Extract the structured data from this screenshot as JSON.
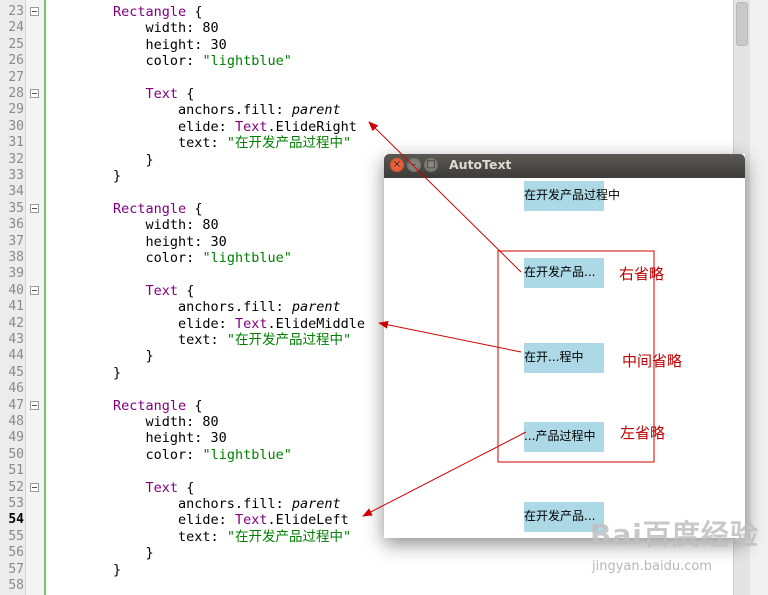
{
  "editor": {
    "current_line": "54",
    "lines": [
      {
        "n": "23",
        "fold": true,
        "segs": [
          {
            "t": "        ",
            "c": ""
          },
          {
            "t": "Rectangle",
            "c": "kw"
          },
          {
            "t": " {",
            "c": ""
          }
        ]
      },
      {
        "n": "24",
        "fold": false,
        "segs": [
          {
            "t": "            width: 80",
            "c": ""
          }
        ]
      },
      {
        "n": "25",
        "fold": false,
        "segs": [
          {
            "t": "            height: 30",
            "c": ""
          }
        ]
      },
      {
        "n": "26",
        "fold": false,
        "segs": [
          {
            "t": "            color: ",
            "c": ""
          },
          {
            "t": "\"lightblue\"",
            "c": "str"
          }
        ]
      },
      {
        "n": "27",
        "fold": false,
        "segs": []
      },
      {
        "n": "28",
        "fold": true,
        "segs": [
          {
            "t": "            ",
            "c": ""
          },
          {
            "t": "Text",
            "c": "kw"
          },
          {
            "t": " {",
            "c": ""
          }
        ]
      },
      {
        "n": "29",
        "fold": false,
        "segs": [
          {
            "t": "                anchors.fill: ",
            "c": ""
          },
          {
            "t": "parent",
            "c": "it"
          }
        ]
      },
      {
        "n": "30",
        "fold": false,
        "segs": [
          {
            "t": "                elide: ",
            "c": ""
          },
          {
            "t": "Text",
            "c": "kw"
          },
          {
            "t": ".ElideRight",
            "c": ""
          }
        ]
      },
      {
        "n": "31",
        "fold": false,
        "segs": [
          {
            "t": "                text: ",
            "c": ""
          },
          {
            "t": "\"在开发产品过程中\"",
            "c": "str"
          }
        ]
      },
      {
        "n": "32",
        "fold": false,
        "segs": [
          {
            "t": "            }",
            "c": ""
          }
        ]
      },
      {
        "n": "33",
        "fold": false,
        "segs": [
          {
            "t": "        }",
            "c": ""
          }
        ]
      },
      {
        "n": "34",
        "fold": false,
        "segs": []
      },
      {
        "n": "35",
        "fold": true,
        "segs": [
          {
            "t": "        ",
            "c": ""
          },
          {
            "t": "Rectangle",
            "c": "kw"
          },
          {
            "t": " {",
            "c": ""
          }
        ]
      },
      {
        "n": "36",
        "fold": false,
        "segs": [
          {
            "t": "            width: 80",
            "c": ""
          }
        ]
      },
      {
        "n": "37",
        "fold": false,
        "segs": [
          {
            "t": "            height: 30",
            "c": ""
          }
        ]
      },
      {
        "n": "38",
        "fold": false,
        "segs": [
          {
            "t": "            color: ",
            "c": ""
          },
          {
            "t": "\"lightblue\"",
            "c": "str"
          }
        ]
      },
      {
        "n": "39",
        "fold": false,
        "segs": []
      },
      {
        "n": "40",
        "fold": true,
        "segs": [
          {
            "t": "            ",
            "c": ""
          },
          {
            "t": "Text",
            "c": "kw"
          },
          {
            "t": " {",
            "c": ""
          }
        ]
      },
      {
        "n": "41",
        "fold": false,
        "segs": [
          {
            "t": "                anchors.fill: ",
            "c": ""
          },
          {
            "t": "parent",
            "c": "it"
          }
        ]
      },
      {
        "n": "42",
        "fold": false,
        "segs": [
          {
            "t": "                elide: ",
            "c": ""
          },
          {
            "t": "Text",
            "c": "kw"
          },
          {
            "t": ".ElideMiddle",
            "c": ""
          }
        ]
      },
      {
        "n": "43",
        "fold": false,
        "segs": [
          {
            "t": "                text: ",
            "c": ""
          },
          {
            "t": "\"在开发产品过程中\"",
            "c": "str"
          }
        ]
      },
      {
        "n": "44",
        "fold": false,
        "segs": [
          {
            "t": "            }",
            "c": ""
          }
        ]
      },
      {
        "n": "45",
        "fold": false,
        "segs": [
          {
            "t": "        }",
            "c": ""
          }
        ]
      },
      {
        "n": "46",
        "fold": false,
        "segs": []
      },
      {
        "n": "47",
        "fold": true,
        "segs": [
          {
            "t": "        ",
            "c": ""
          },
          {
            "t": "Rectangle",
            "c": "kw"
          },
          {
            "t": " {",
            "c": ""
          }
        ]
      },
      {
        "n": "48",
        "fold": false,
        "segs": [
          {
            "t": "            width: 80",
            "c": ""
          }
        ]
      },
      {
        "n": "49",
        "fold": false,
        "segs": [
          {
            "t": "            height: 30",
            "c": ""
          }
        ]
      },
      {
        "n": "50",
        "fold": false,
        "segs": [
          {
            "t": "            color: ",
            "c": ""
          },
          {
            "t": "\"lightblue\"",
            "c": "str"
          }
        ]
      },
      {
        "n": "51",
        "fold": false,
        "segs": []
      },
      {
        "n": "52",
        "fold": true,
        "segs": [
          {
            "t": "            ",
            "c": ""
          },
          {
            "t": "Text",
            "c": "kw"
          },
          {
            "t": " {",
            "c": ""
          }
        ]
      },
      {
        "n": "53",
        "fold": false,
        "segs": [
          {
            "t": "                anchors.fill: ",
            "c": ""
          },
          {
            "t": "parent",
            "c": "it"
          }
        ]
      },
      {
        "n": "54",
        "fold": false,
        "segs": [
          {
            "t": "                elide: ",
            "c": ""
          },
          {
            "t": "Text",
            "c": "kw"
          },
          {
            "t": ".ElideLeft",
            "c": ""
          }
        ]
      },
      {
        "n": "55",
        "fold": false,
        "segs": [
          {
            "t": "                text: ",
            "c": ""
          },
          {
            "t": "\"在开发产品过程中\"",
            "c": "str"
          }
        ]
      },
      {
        "n": "56",
        "fold": false,
        "segs": [
          {
            "t": "            }",
            "c": ""
          }
        ]
      },
      {
        "n": "57",
        "fold": false,
        "segs": [
          {
            "t": "        }",
            "c": ""
          }
        ]
      },
      {
        "n": "58",
        "fold": false,
        "segs": []
      }
    ]
  },
  "autotext_window": {
    "title": "AutoText",
    "close_glyph": "×",
    "min_glyph": "–",
    "max_glyph": "□",
    "boxes": [
      {
        "text": "在开发产品过程中"
      },
      {
        "text": "在开发产品..."
      },
      {
        "text": "在开...程中"
      },
      {
        "text": "...产品过程中"
      },
      {
        "text": "在开发产品..."
      }
    ],
    "box_color": "#add8e6"
  },
  "annotations": {
    "right_elide": "右省略",
    "middle_elide": "中间省略",
    "left_elide": "左省略",
    "color": "#d00000"
  },
  "watermark": {
    "logo": "Bai百度经验",
    "url": "jingyan.baidu.com"
  }
}
